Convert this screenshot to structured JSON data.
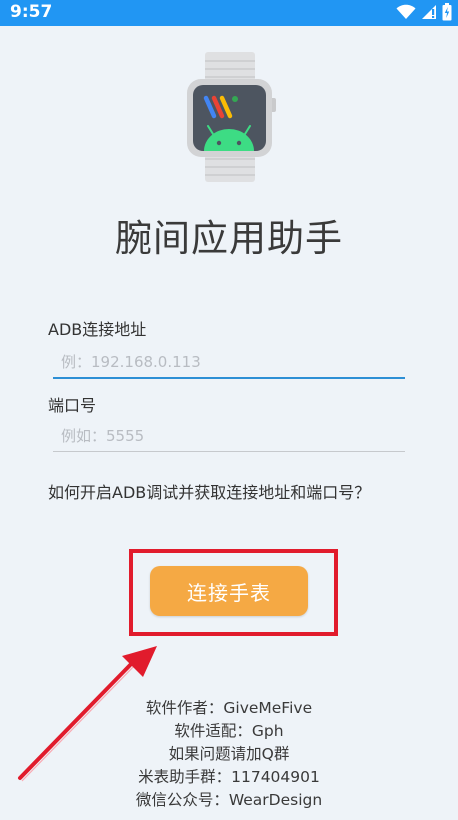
{
  "status_bar": {
    "time": "9:57",
    "icons": [
      "wifi-icon",
      "signal-icon",
      "battery-icon"
    ],
    "background_color": "#2196f3"
  },
  "app": {
    "title": "腕间应用助手",
    "logo_icon": "watch-android-icon"
  },
  "form": {
    "adb_address": {
      "label": "ADB连接地址",
      "placeholder": "例：192.168.0.113",
      "value": ""
    },
    "port": {
      "label": "端口号",
      "placeholder": "例如：5555",
      "value": ""
    },
    "help_text": "如何开启ADB调试并获取连接地址和端口号？"
  },
  "connect_button": {
    "label": "连接手表",
    "color": "#f5a944",
    "highlight_color": "#e11b2c"
  },
  "credits": {
    "author": "软件作者：GiveMeFive",
    "adapter": "软件适配：Gph",
    "issue": "如果问题请加Q群",
    "group": "米表助手群：117404901",
    "wechat": "微信公众号：WearDesign"
  }
}
